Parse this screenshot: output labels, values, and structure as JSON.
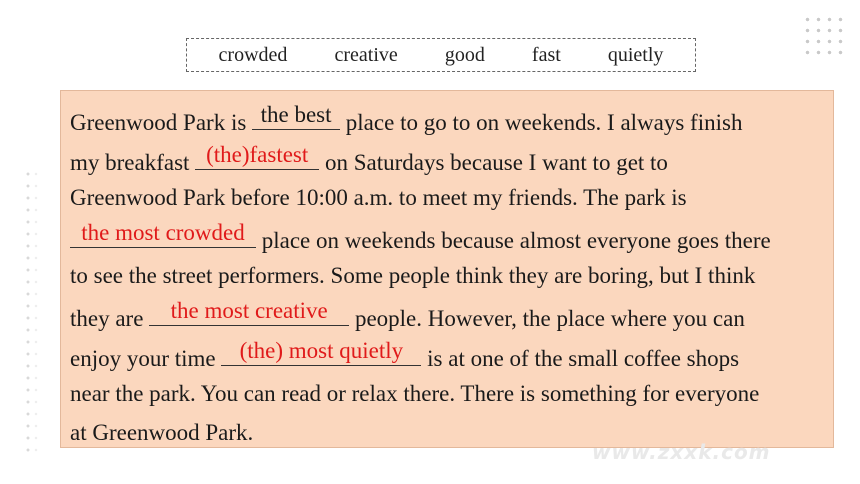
{
  "word_bank": [
    "crowded",
    "creative",
    "good",
    "fast",
    "quietly"
  ],
  "passage": {
    "l1_a": "Greenwood Park is ",
    "l1_blank": "the best",
    "l1_b": " place to go to on weekends. I always finish",
    "l2_a": "my breakfast ",
    "l2_blank": "(the)fastest",
    "l2_b": " on Saturdays because I want to get to",
    "l3": "Greenwood Park before 10:00 a.m. to meet my friends. The park is",
    "l4_blank": "the most crowded",
    "l4_b": " place on weekends because almost everyone goes there",
    "l5": "to see the street performers. Some people think they are boring, but I think",
    "l6_a": "they are ",
    "l6_blank": "the most creative",
    "l6_b": " people. However, the place where you can",
    "l7_a": "enjoy your time ",
    "l7_blank": "(the) most quietly",
    "l7_b": " is at one of the small coffee shops",
    "l8": "near the park. You can read or relax there. There is something for everyone",
    "l9": "at Greenwood Park."
  },
  "colors": {
    "passage_bg": "#fbd7be",
    "answer": "#e01a1a"
  },
  "watermark": "www.zxxk.com"
}
